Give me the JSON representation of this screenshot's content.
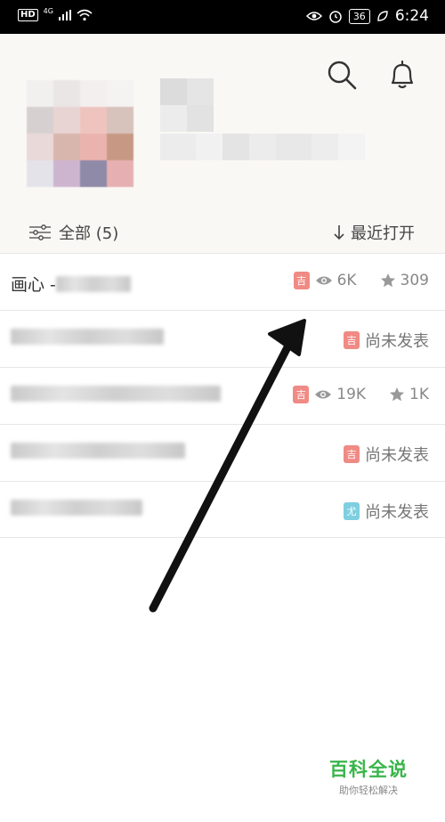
{
  "status_bar": {
    "left_label": "HD",
    "network": "4G",
    "battery": "36",
    "time": "6:24"
  },
  "header": {
    "search_icon": "search-icon",
    "bell_icon": "bell-icon"
  },
  "filter": {
    "all_label": "全部 (5)",
    "sort_label": "最近打开"
  },
  "list": [
    {
      "title_visible": "画心 - ",
      "badge": "吉",
      "badge_type": "ji",
      "views": "6K",
      "stars": "309",
      "published": true
    },
    {
      "title_visible": "",
      "badge": "吉",
      "badge_type": "ji",
      "status": "尚未发表",
      "published": false
    },
    {
      "title_visible": "",
      "badge": "吉",
      "badge_type": "ji",
      "views": "19K",
      "stars": "1K",
      "published": true
    },
    {
      "title_visible": "",
      "badge": "吉",
      "badge_type": "ji",
      "status": "尚未发表",
      "published": false
    },
    {
      "title_visible": "",
      "badge": "尤",
      "badge_type": "you",
      "status": "尚未发表",
      "published": false
    }
  ],
  "watermark": {
    "title": "百科全说",
    "subtitle": "助你轻松解决"
  },
  "colors": {
    "badge_ji": "#f08a85",
    "badge_you": "#7fcfe0",
    "watermark_green": "#39b54a"
  }
}
